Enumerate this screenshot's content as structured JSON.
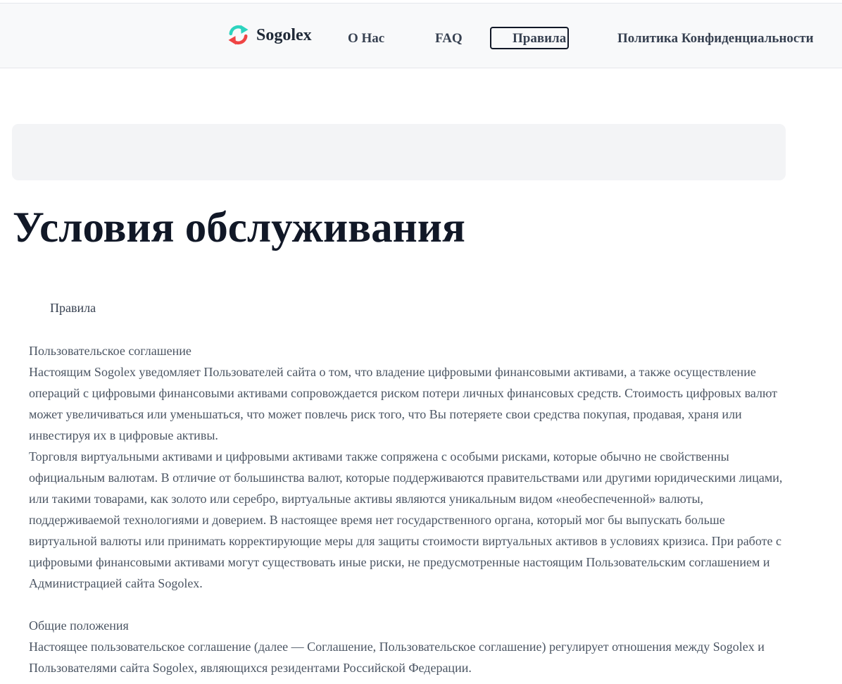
{
  "header": {
    "brand": "Sogolex",
    "nav": {
      "about": "О Нас",
      "faq": "FAQ",
      "rules": "Правила",
      "privacy": "Политика Конфиденциальности"
    },
    "colors": {
      "logo_arrow_top": "#2dd4bf",
      "logo_arrow_bottom": "#ef4444"
    }
  },
  "main": {
    "title": "Условия обслуживания",
    "rules_label": "Правила",
    "sections": [
      {
        "heading": "Пользовательское соглашение",
        "paragraphs": [
          "Настоящим Sogolex уведомляет Пользователей сайта о том, что владение цифровыми финансовыми активами, а также осуществление операций с цифровыми финансовыми активами сопровождается риском потери личных финансовых средств. Стоимость цифровых валют может увеличиваться или уменьшаться, что может повлечь риск того, что Вы потеряете свои средства покупая, продавая, храня или инвестируя их в цифровые активы.",
          "Торговля виртуальными активами и цифровыми активами также сопряжена с особыми рисками, которые обычно не свойственны официальным валютам. В отличие от большинства валют, которые поддерживаются правительствами или другими юридическими лицами, или такими товарами, как золото или серебро, виртуальные активы являются уникальным видом «необеспеченной» валюты, поддерживаемой технологиями и доверием. В настоящее время нет государственного органа, который мог бы выпускать больше виртуальной валюты или принимать корректирующие меры для защиты стоимости виртуальных активов в условиях кризиса. При работе с цифровыми финансовыми активами могут существовать иные риски, не предусмотренные настоящим Пользовательским соглашением и Администрацией сайта Sogolex."
        ]
      },
      {
        "heading": "Общие положения",
        "paragraphs": [
          "Настоящее пользовательское соглашение (далее — Соглашение, Пользовательское соглашение) регулирует отношения между Sogolex и Пользователями сайта Sogolex, являющихся резидентами Российской Федерации."
        ]
      }
    ]
  }
}
